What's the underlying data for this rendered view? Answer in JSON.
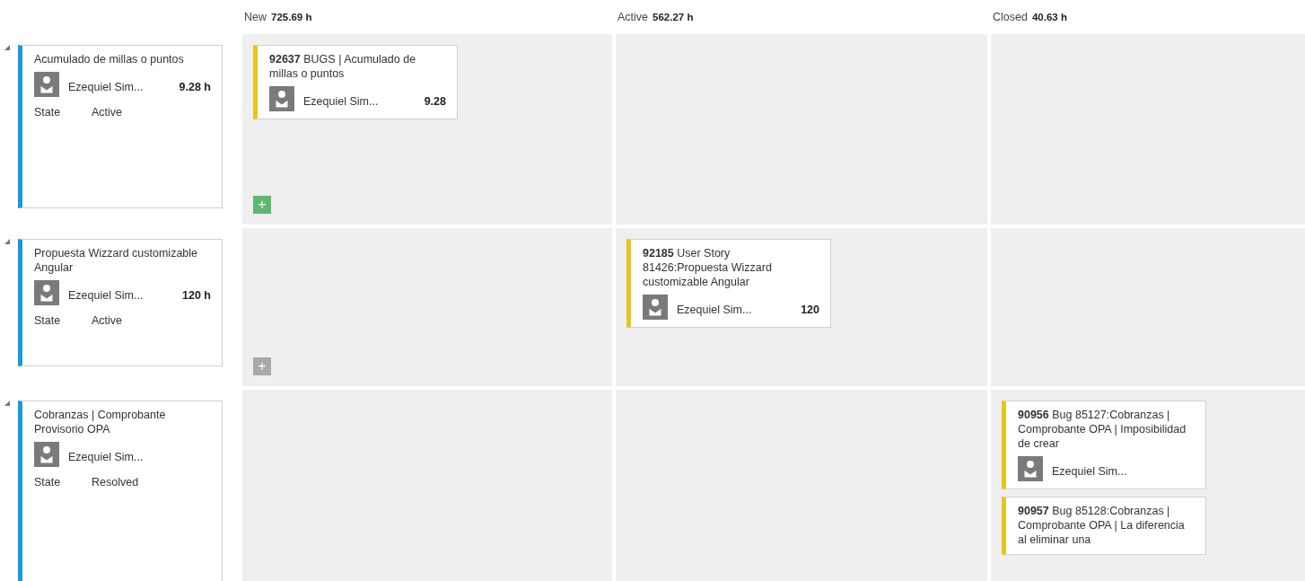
{
  "columns": [
    {
      "name": "New",
      "total": "725.69 h"
    },
    {
      "name": "Active",
      "total": "562.27 h"
    },
    {
      "name": "Closed",
      "total": "40.63 h"
    }
  ],
  "rows": [
    {
      "expanded": true,
      "parent": {
        "title": "Acumulado de millas o puntos",
        "assignee": "Ezequiel Sim...",
        "hours": "9.28 h",
        "field_label": "State",
        "field_value": "Active"
      },
      "add_button": {
        "label": "+",
        "disabled": false
      },
      "cells": [
        [
          {
            "title": "**92637**  BUGS | Acumulado de millas o puntos",
            "assignee": "Ezequiel Sim...",
            "estimate": "9.28"
          }
        ],
        [],
        []
      ]
    },
    {
      "expanded": true,
      "parent": {
        "title": "Propuesta Wizzard customizable Angular",
        "assignee": "Ezequiel Sim...",
        "hours": "120 h",
        "field_label": "State",
        "field_value": "Active"
      },
      "add_button": {
        "label": "+",
        "disabled": true
      },
      "cells": [
        [],
        [
          {
            "title": "**92185**  User Story 81426:Propuesta Wizzard customizable Angular",
            "assignee": "Ezequiel Sim...",
            "estimate": "120"
          }
        ],
        []
      ]
    },
    {
      "expanded": true,
      "parent": {
        "title": "Cobranzas | Comprobante Provisorio OPA",
        "assignee": "Ezequiel Sim...",
        "field_label": "State",
        "field_value": "Resolved"
      },
      "cells": [
        [],
        [],
        [
          {
            "title": "**90956**  Bug 85127:Cobranzas | Comprobante OPA | Imposibilidad de crear",
            "assignee": "Ezequiel Sim..."
          },
          {
            "title": "**90957**  Bug 85128:Cobranzas | Comprobante OPA | La diferencia al eliminar una"
          }
        ]
      ]
    }
  ]
}
